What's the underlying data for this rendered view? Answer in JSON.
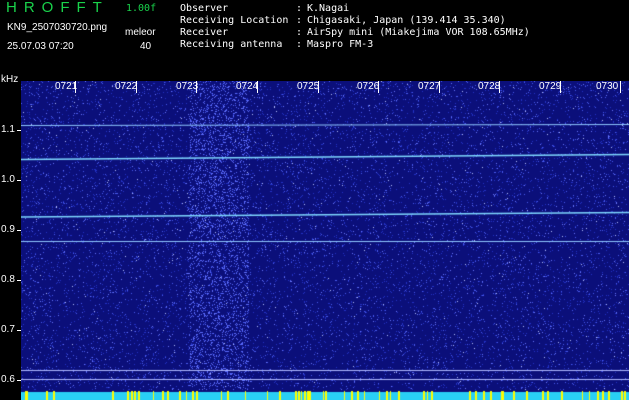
{
  "app": {
    "title": "HROFFT",
    "version": "1.00f"
  },
  "file": {
    "name": "KN9_2507030720.png",
    "datetime": "25.07.03 07:20"
  },
  "meleor": {
    "label": "meleor",
    "count": "40"
  },
  "metadata": [
    {
      "key": "Observer",
      "value": "K.Nagai"
    },
    {
      "key": "Receiving Location",
      "value": "Chigasaki, Japan (139.414 35.340)"
    },
    {
      "key": "Receiver",
      "value": "AirSpy mini (Miakejima VOR 108.65MHz)"
    },
    {
      "key": "Receiving antenna",
      "value": "Maspro FM-3"
    }
  ],
  "axis": {
    "unit": "kHz",
    "y_labels": [
      "1.1",
      "1.0",
      "0.9",
      "0.8",
      "0.7",
      "0.6"
    ],
    "x_labels": [
      "0721",
      "0722",
      "0723",
      "0724",
      "0725",
      "0726",
      "0727",
      "0728",
      "0729",
      "0730"
    ]
  },
  "colors": {
    "title_green": "#19d24b",
    "spectrogram_bg": "#0b0f7a",
    "noise_bright": "#6a78ff",
    "carrier_line": "#7fd8ff",
    "bottom_bar": "#29d0f5",
    "bottom_spikes": "#ffff00"
  }
}
